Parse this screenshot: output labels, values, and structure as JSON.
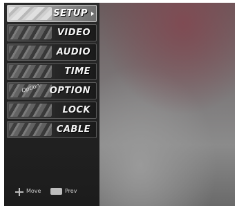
{
  "menu": {
    "items": [
      {
        "label": "SETUP",
        "selected": true,
        "icon": "setup-icon"
      },
      {
        "label": "VIDEO",
        "selected": false,
        "icon": "video-icon"
      },
      {
        "label": "AUDIO",
        "selected": false,
        "icon": "audio-icon"
      },
      {
        "label": "TIME",
        "selected": false,
        "icon": "time-icon"
      },
      {
        "label": "OPTION",
        "selected": false,
        "icon": "option-icon"
      },
      {
        "label": "LOCK",
        "selected": false,
        "icon": "lock-icon"
      },
      {
        "label": "CABLE",
        "selected": false,
        "icon": "cable-icon"
      }
    ],
    "option_badge": "Option"
  },
  "footer": {
    "move_label": "Move",
    "prev_label": "Prev"
  }
}
